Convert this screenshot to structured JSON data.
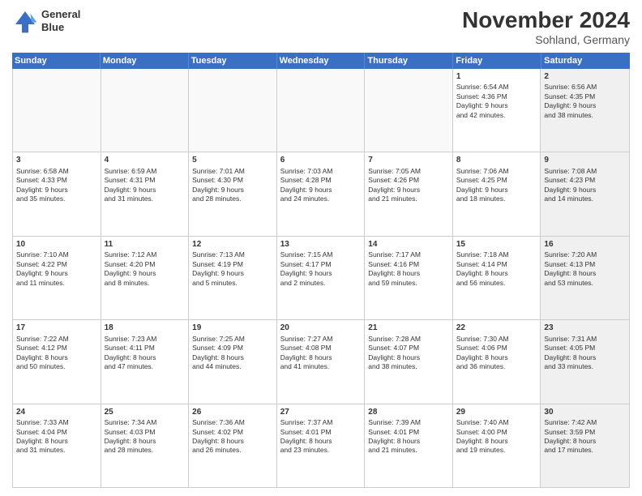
{
  "logo": {
    "line1": "General",
    "line2": "Blue"
  },
  "title": "November 2024",
  "subtitle": "Sohland, Germany",
  "headers": [
    "Sunday",
    "Monday",
    "Tuesday",
    "Wednesday",
    "Thursday",
    "Friday",
    "Saturday"
  ],
  "rows": [
    [
      {
        "day": "",
        "info": "",
        "empty": true
      },
      {
        "day": "",
        "info": "",
        "empty": true
      },
      {
        "day": "",
        "info": "",
        "empty": true
      },
      {
        "day": "",
        "info": "",
        "empty": true
      },
      {
        "day": "",
        "info": "",
        "empty": true
      },
      {
        "day": "1",
        "info": "Sunrise: 6:54 AM\nSunset: 4:36 PM\nDaylight: 9 hours\nand 42 minutes.",
        "empty": false
      },
      {
        "day": "2",
        "info": "Sunrise: 6:56 AM\nSunset: 4:35 PM\nDaylight: 9 hours\nand 38 minutes.",
        "empty": false,
        "shaded": true
      }
    ],
    [
      {
        "day": "3",
        "info": "Sunrise: 6:58 AM\nSunset: 4:33 PM\nDaylight: 9 hours\nand 35 minutes.",
        "empty": false
      },
      {
        "day": "4",
        "info": "Sunrise: 6:59 AM\nSunset: 4:31 PM\nDaylight: 9 hours\nand 31 minutes.",
        "empty": false
      },
      {
        "day": "5",
        "info": "Sunrise: 7:01 AM\nSunset: 4:30 PM\nDaylight: 9 hours\nand 28 minutes.",
        "empty": false
      },
      {
        "day": "6",
        "info": "Sunrise: 7:03 AM\nSunset: 4:28 PM\nDaylight: 9 hours\nand 24 minutes.",
        "empty": false
      },
      {
        "day": "7",
        "info": "Sunrise: 7:05 AM\nSunset: 4:26 PM\nDaylight: 9 hours\nand 21 minutes.",
        "empty": false
      },
      {
        "day": "8",
        "info": "Sunrise: 7:06 AM\nSunset: 4:25 PM\nDaylight: 9 hours\nand 18 minutes.",
        "empty": false
      },
      {
        "day": "9",
        "info": "Sunrise: 7:08 AM\nSunset: 4:23 PM\nDaylight: 9 hours\nand 14 minutes.",
        "empty": false,
        "shaded": true
      }
    ],
    [
      {
        "day": "10",
        "info": "Sunrise: 7:10 AM\nSunset: 4:22 PM\nDaylight: 9 hours\nand 11 minutes.",
        "empty": false
      },
      {
        "day": "11",
        "info": "Sunrise: 7:12 AM\nSunset: 4:20 PM\nDaylight: 9 hours\nand 8 minutes.",
        "empty": false
      },
      {
        "day": "12",
        "info": "Sunrise: 7:13 AM\nSunset: 4:19 PM\nDaylight: 9 hours\nand 5 minutes.",
        "empty": false
      },
      {
        "day": "13",
        "info": "Sunrise: 7:15 AM\nSunset: 4:17 PM\nDaylight: 9 hours\nand 2 minutes.",
        "empty": false
      },
      {
        "day": "14",
        "info": "Sunrise: 7:17 AM\nSunset: 4:16 PM\nDaylight: 8 hours\nand 59 minutes.",
        "empty": false
      },
      {
        "day": "15",
        "info": "Sunrise: 7:18 AM\nSunset: 4:14 PM\nDaylight: 8 hours\nand 56 minutes.",
        "empty": false
      },
      {
        "day": "16",
        "info": "Sunrise: 7:20 AM\nSunset: 4:13 PM\nDaylight: 8 hours\nand 53 minutes.",
        "empty": false,
        "shaded": true
      }
    ],
    [
      {
        "day": "17",
        "info": "Sunrise: 7:22 AM\nSunset: 4:12 PM\nDaylight: 8 hours\nand 50 minutes.",
        "empty": false
      },
      {
        "day": "18",
        "info": "Sunrise: 7:23 AM\nSunset: 4:11 PM\nDaylight: 8 hours\nand 47 minutes.",
        "empty": false
      },
      {
        "day": "19",
        "info": "Sunrise: 7:25 AM\nSunset: 4:09 PM\nDaylight: 8 hours\nand 44 minutes.",
        "empty": false
      },
      {
        "day": "20",
        "info": "Sunrise: 7:27 AM\nSunset: 4:08 PM\nDaylight: 8 hours\nand 41 minutes.",
        "empty": false
      },
      {
        "day": "21",
        "info": "Sunrise: 7:28 AM\nSunset: 4:07 PM\nDaylight: 8 hours\nand 38 minutes.",
        "empty": false
      },
      {
        "day": "22",
        "info": "Sunrise: 7:30 AM\nSunset: 4:06 PM\nDaylight: 8 hours\nand 36 minutes.",
        "empty": false
      },
      {
        "day": "23",
        "info": "Sunrise: 7:31 AM\nSunset: 4:05 PM\nDaylight: 8 hours\nand 33 minutes.",
        "empty": false,
        "shaded": true
      }
    ],
    [
      {
        "day": "24",
        "info": "Sunrise: 7:33 AM\nSunset: 4:04 PM\nDaylight: 8 hours\nand 31 minutes.",
        "empty": false
      },
      {
        "day": "25",
        "info": "Sunrise: 7:34 AM\nSunset: 4:03 PM\nDaylight: 8 hours\nand 28 minutes.",
        "empty": false
      },
      {
        "day": "26",
        "info": "Sunrise: 7:36 AM\nSunset: 4:02 PM\nDaylight: 8 hours\nand 26 minutes.",
        "empty": false
      },
      {
        "day": "27",
        "info": "Sunrise: 7:37 AM\nSunset: 4:01 PM\nDaylight: 8 hours\nand 23 minutes.",
        "empty": false
      },
      {
        "day": "28",
        "info": "Sunrise: 7:39 AM\nSunset: 4:01 PM\nDaylight: 8 hours\nand 21 minutes.",
        "empty": false
      },
      {
        "day": "29",
        "info": "Sunrise: 7:40 AM\nSunset: 4:00 PM\nDaylight: 8 hours\nand 19 minutes.",
        "empty": false
      },
      {
        "day": "30",
        "info": "Sunrise: 7:42 AM\nSunset: 3:59 PM\nDaylight: 8 hours\nand 17 minutes.",
        "empty": false,
        "shaded": true
      }
    ]
  ]
}
